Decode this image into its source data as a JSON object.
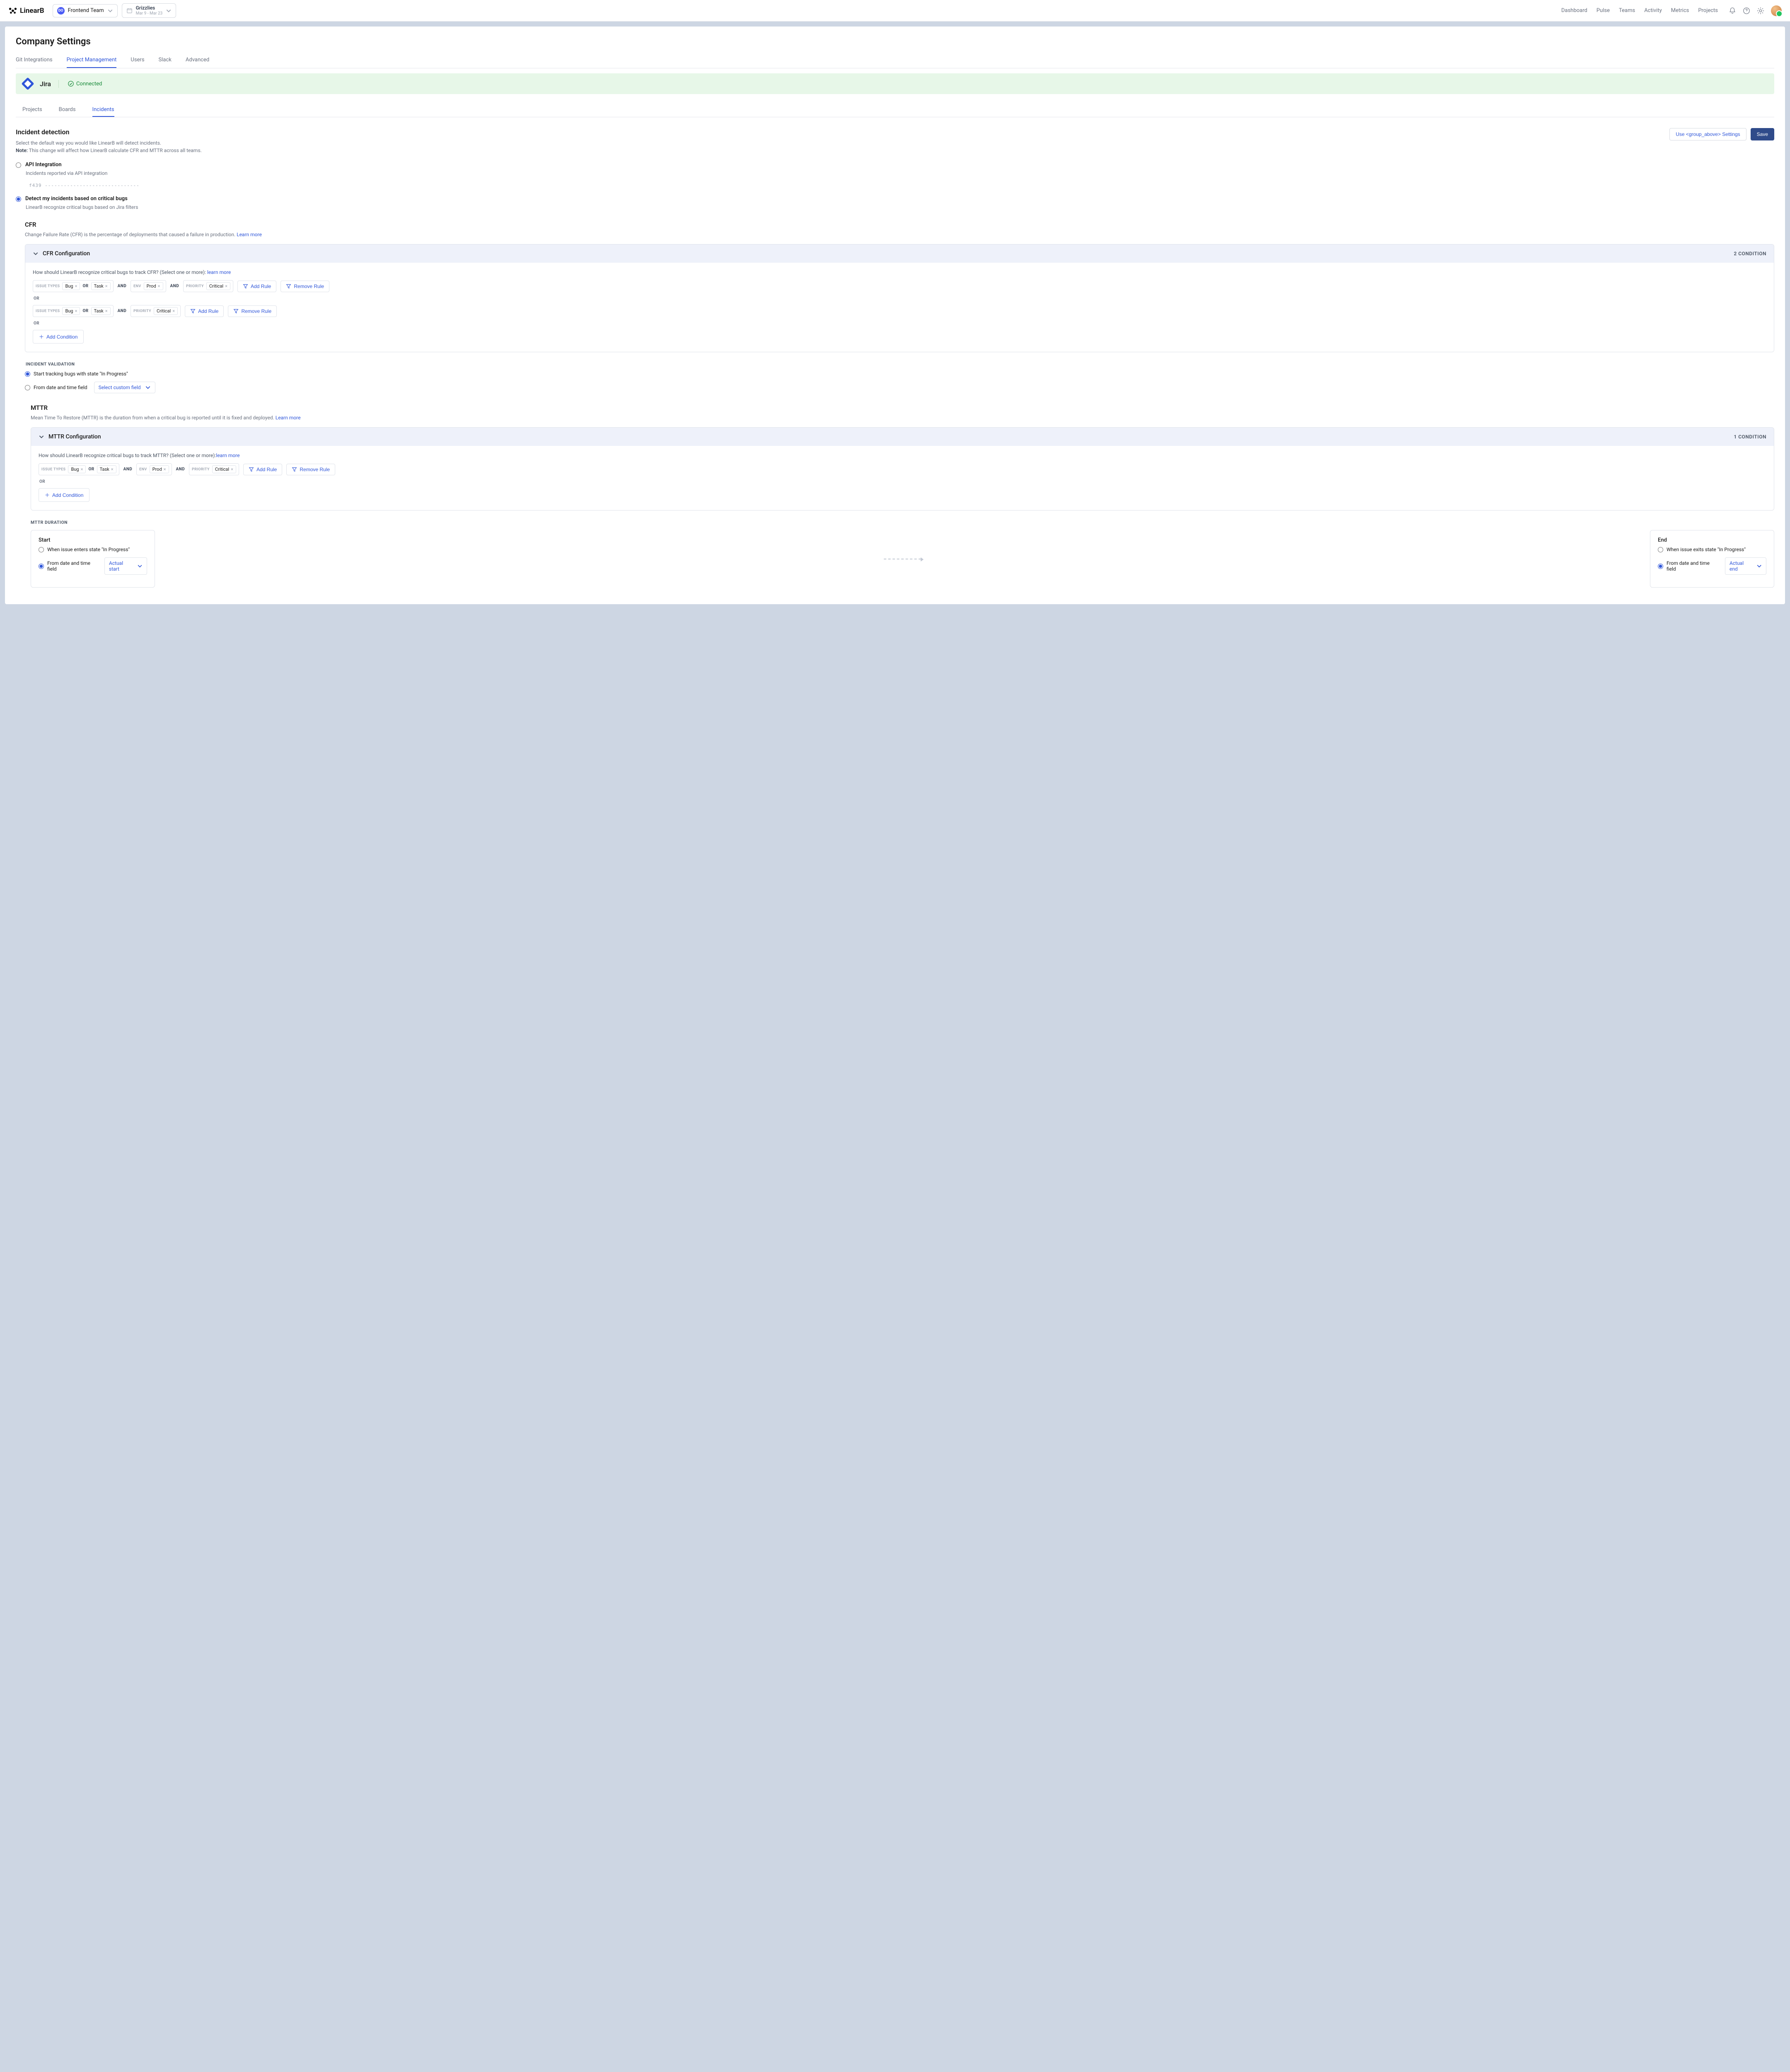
{
  "topbar": {
    "brand": "LinearB",
    "teamBadge": "DO",
    "teamName": "Frontend Team",
    "projectName": "Grizzlies",
    "projectRange": "Mar 9 - Mar 23",
    "nav": [
      "Dashboard",
      "Pulse",
      "Teams",
      "Activity",
      "Metrics",
      "Projects"
    ]
  },
  "page": {
    "title": "Company Settings",
    "tabs": [
      "Git Integrations",
      "Project Management",
      "Users",
      "Slack",
      "Advanced"
    ],
    "activeTab": "Project Management"
  },
  "jira": {
    "name": "Jira",
    "status": "Connected"
  },
  "subtabs": [
    "Projects",
    "Boards",
    "Incidents"
  ],
  "activeSubtab": "Incidents",
  "incident": {
    "title": "Incident detection",
    "desc": "Select the default way you would like LinearB will detect incidents.",
    "noteLabel": "Note:",
    "note": "This change will affect how LinearB calculate CFR and MTTR across all teams.",
    "useBtn": "Use <group_above> Settings",
    "saveBtn": "Save",
    "opt1": {
      "label": "API Integration",
      "sub": "Incidents reported via API integration",
      "code": "f439 ------------------------------"
    },
    "opt2": {
      "label": "Detect my incidents based on critical bugs",
      "sub": "LinearB recognize critical bugs based on Jira filters"
    }
  },
  "cfr": {
    "title": "CFR",
    "desc": "Change Failure Rate (CFR) is the percentage of deployments that caused a failure in production. ",
    "learn": "Learn more",
    "configTitle": "CFR Configuration",
    "condCount": "2 CONDITION",
    "question": "How should LinearB recognize critical bugs to track CFR? (Select one or more):  ",
    "learnMore": "learn more"
  },
  "mttr": {
    "title": "MTTR",
    "desc": "Mean Time To Restore (MTTR) is the duration from when a critical bug is reported until it is fixed and deployed. ",
    "learn": "Learn more",
    "configTitle": "MTTR Configuration",
    "condCount": "1 CONDITION",
    "question": "How should LinearB recognize critical bugs to track MTTR? (Select one or more):",
    "learnMore": "learn more"
  },
  "labels": {
    "issueTypes": "ISSUE TYPES",
    "env": "ENV",
    "priority": "PRIORITY",
    "bug": "Bug",
    "task": "Task",
    "prod": "Prod",
    "critical": "Critical",
    "and": "AND",
    "or": "OR",
    "addRule": "Add Rule",
    "removeRule": "Remove Rule",
    "addCondition": "Add Condition",
    "incidentValidation": "INCIDENT VALIDATION",
    "startTracking": "Start tracking bugs with state \"In Progress\"",
    "fromDateField": "From date and time field",
    "selectCustom": "Select custom field",
    "mttrDuration": "MTTR DURATION",
    "start": "Start",
    "end": "End",
    "whenEnter": "When issue enters state \"In Progress\"",
    "whenExit": "When issue exits state \"In Progress\"",
    "actualStart": "Actual start",
    "actualEnd": "Actual end"
  }
}
